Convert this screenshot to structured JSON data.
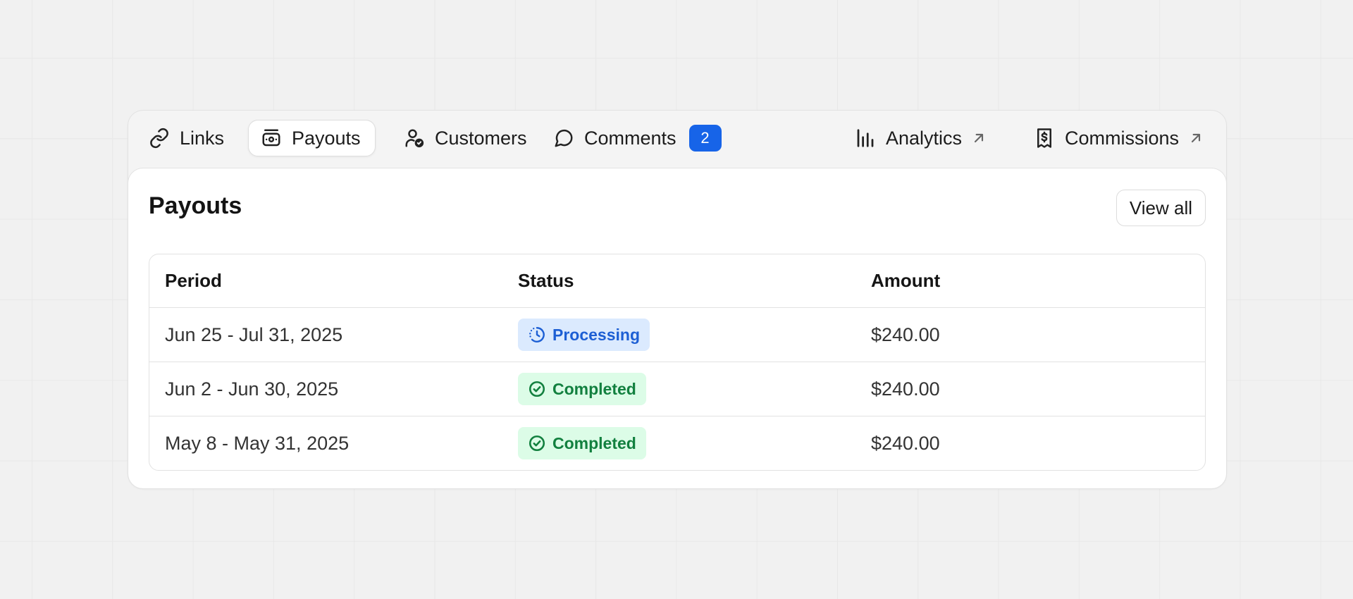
{
  "tabs": [
    {
      "label": "Links",
      "icon": "link-icon"
    },
    {
      "label": "Payouts",
      "icon": "money-icon",
      "active": true
    },
    {
      "label": "Customers",
      "icon": "user-check-icon"
    },
    {
      "label": "Comments",
      "icon": "chat-bubble-icon",
      "badge": "2"
    },
    {
      "label": "Analytics",
      "icon": "bar-chart-icon",
      "external": true
    },
    {
      "label": "Commissions",
      "icon": "receipt-dollar-icon",
      "external": true
    }
  ],
  "panel": {
    "title": "Payouts",
    "view_all_label": "View all"
  },
  "table": {
    "headers": [
      "Period",
      "Status",
      "Amount"
    ],
    "rows": [
      {
        "period": "Jun 25 - Jul 31, 2025",
        "status": "Processing",
        "amount": "$240.00"
      },
      {
        "period": "Jun 2 - Jun 30, 2025",
        "status": "Completed",
        "amount": "$240.00"
      },
      {
        "period": "May 8 - May 31, 2025",
        "status": "Completed",
        "amount": "$240.00"
      }
    ]
  },
  "colors": {
    "badge": "#1764e8",
    "processing_bg": "#dbeafe",
    "processing_text": "#1d5fd4",
    "completed_bg": "#dcfce7",
    "completed_text": "#12803f"
  }
}
